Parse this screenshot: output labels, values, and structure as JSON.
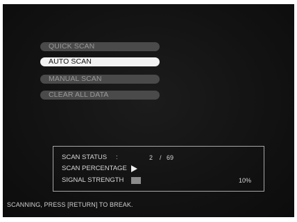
{
  "menu": {
    "items": [
      {
        "label": "QUICK SCAN",
        "selected": false
      },
      {
        "label": "AUTO SCAN",
        "selected": true
      },
      {
        "label": "MANUAL SCAN",
        "selected": false
      },
      {
        "label": "CLEAR ALL DATA",
        "selected": false
      }
    ]
  },
  "status": {
    "scan_status_label": "SCAN STATUS",
    "colon": ":",
    "current": "2",
    "separator": "/",
    "total": "69",
    "scan_percentage_label": "SCAN PERCENTAGE",
    "scan_percentage_icon": "play-arrow-icon",
    "signal_strength_label": "SIGNAL STRENGTH",
    "signal_strength_value": "10%",
    "signal_strength_level": 0.1
  },
  "footer": {
    "hint": "SCANNING, PRESS [RETURN] TO BREAK."
  },
  "colors": {
    "screen_background": "#121212",
    "menu_item": "#4a4a4a",
    "menu_item_selected": "#f2f2f2"
  }
}
